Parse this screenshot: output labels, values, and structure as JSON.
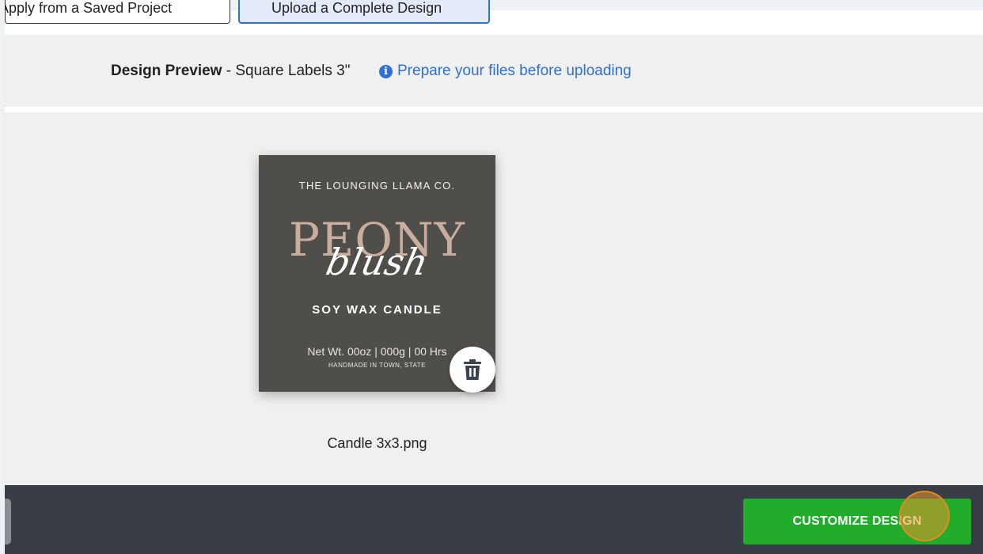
{
  "tabs": {
    "saved_project_label": "Apply from a Saved Project",
    "upload_design_label": "Upload a Complete Design"
  },
  "preview": {
    "title_bold": "Design Preview",
    "title_rest": " - Square Labels 3\"",
    "prepare_link": "Prepare your files before uploading",
    "info_icon": "info-circle-icon"
  },
  "design": {
    "brand": "THE LOUNGING LLAMA CO.",
    "title": "PEONY",
    "script": "blush",
    "product": "SOY WAX CANDLE",
    "net": "Net Wt. 00oz | 000g | 00 Hrs",
    "handmade": "HANDMADE IN TOWN, STATE",
    "file_name": "Candle 3x3.png",
    "delete_icon": "trash-icon"
  },
  "footer": {
    "customize_label": "CUSTOMIZE DESIGN"
  },
  "colors": {
    "accent_blue": "#2f6fd6",
    "button_green": "#22ac2c",
    "footer_bg": "#393d46",
    "label_bg": "#4f4e4b",
    "peony_color": "#c9ae9f"
  }
}
